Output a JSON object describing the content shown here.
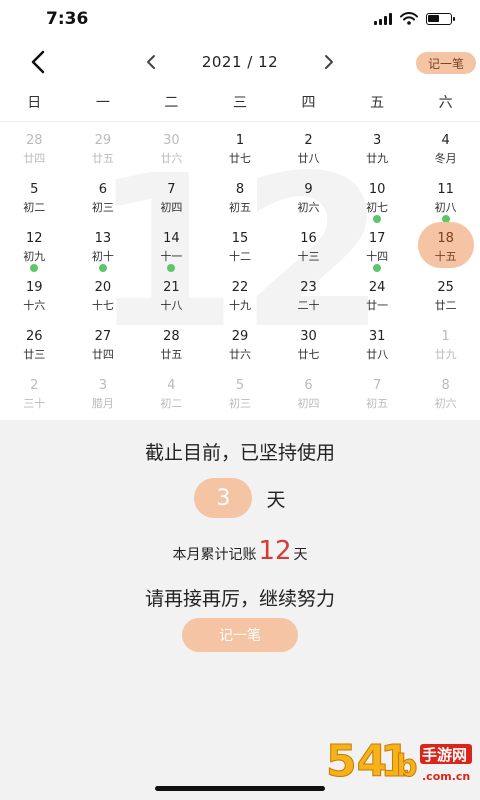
{
  "status_bar": {
    "time": "7:36"
  },
  "header": {
    "month_label": "2021 / 12",
    "record_button": "记一笔"
  },
  "calendar": {
    "watermark": "12",
    "weekdays": [
      "日",
      "一",
      "二",
      "三",
      "四",
      "五",
      "六"
    ],
    "weeks": [
      [
        {
          "d": "28",
          "l": "廿四",
          "out": true
        },
        {
          "d": "29",
          "l": "廿五",
          "out": true
        },
        {
          "d": "30",
          "l": "廿六",
          "out": true
        },
        {
          "d": "1",
          "l": "廿七"
        },
        {
          "d": "2",
          "l": "廿八"
        },
        {
          "d": "3",
          "l": "廿九"
        },
        {
          "d": "4",
          "l": "冬月"
        }
      ],
      [
        {
          "d": "5",
          "l": "初二"
        },
        {
          "d": "6",
          "l": "初三"
        },
        {
          "d": "7",
          "l": "初四"
        },
        {
          "d": "8",
          "l": "初五"
        },
        {
          "d": "9",
          "l": "初六"
        },
        {
          "d": "10",
          "l": "初七",
          "dot": true
        },
        {
          "d": "11",
          "l": "初八",
          "dot": true
        }
      ],
      [
        {
          "d": "12",
          "l": "初九",
          "dot": true
        },
        {
          "d": "13",
          "l": "初十",
          "dot": true
        },
        {
          "d": "14",
          "l": "十一",
          "dot": true
        },
        {
          "d": "15",
          "l": "十二"
        },
        {
          "d": "16",
          "l": "十三"
        },
        {
          "d": "17",
          "l": "十四",
          "dot": true
        },
        {
          "d": "18",
          "l": "十五",
          "selected": true
        }
      ],
      [
        {
          "d": "19",
          "l": "十六"
        },
        {
          "d": "20",
          "l": "十七"
        },
        {
          "d": "21",
          "l": "十八"
        },
        {
          "d": "22",
          "l": "十九"
        },
        {
          "d": "23",
          "l": "二十"
        },
        {
          "d": "24",
          "l": "廿一"
        },
        {
          "d": "25",
          "l": "廿二"
        }
      ],
      [
        {
          "d": "26",
          "l": "廿三"
        },
        {
          "d": "27",
          "l": "廿四"
        },
        {
          "d": "28",
          "l": "廿五"
        },
        {
          "d": "29",
          "l": "廿六"
        },
        {
          "d": "30",
          "l": "廿七"
        },
        {
          "d": "31",
          "l": "廿八"
        },
        {
          "d": "1",
          "l": "廿九",
          "out": true
        }
      ],
      [
        {
          "d": "2",
          "l": "三十",
          "out": true
        },
        {
          "d": "3",
          "l": "腊月",
          "out": true
        },
        {
          "d": "4",
          "l": "初二",
          "out": true
        },
        {
          "d": "5",
          "l": "初三",
          "out": true
        },
        {
          "d": "6",
          "l": "初四",
          "out": true
        },
        {
          "d": "7",
          "l": "初五",
          "out": true
        },
        {
          "d": "8",
          "l": "初六",
          "out": true
        }
      ]
    ]
  },
  "summary": {
    "title": "截止目前，已坚持使用",
    "days_count": "3",
    "days_unit": "天",
    "month_prefix": "本月累计记账",
    "month_count": "12",
    "month_suffix": "天",
    "encourage": "请再接再厉，继续努力",
    "record_button": "记一笔"
  },
  "colors": {
    "accent": "#f4c4a4",
    "record_dot": "#5cc76a",
    "count_red": "#d43b33"
  },
  "icons": {
    "back": "chevron-left-icon",
    "prev_month": "chevron-left-icon",
    "next_month": "chevron-right-icon"
  }
}
